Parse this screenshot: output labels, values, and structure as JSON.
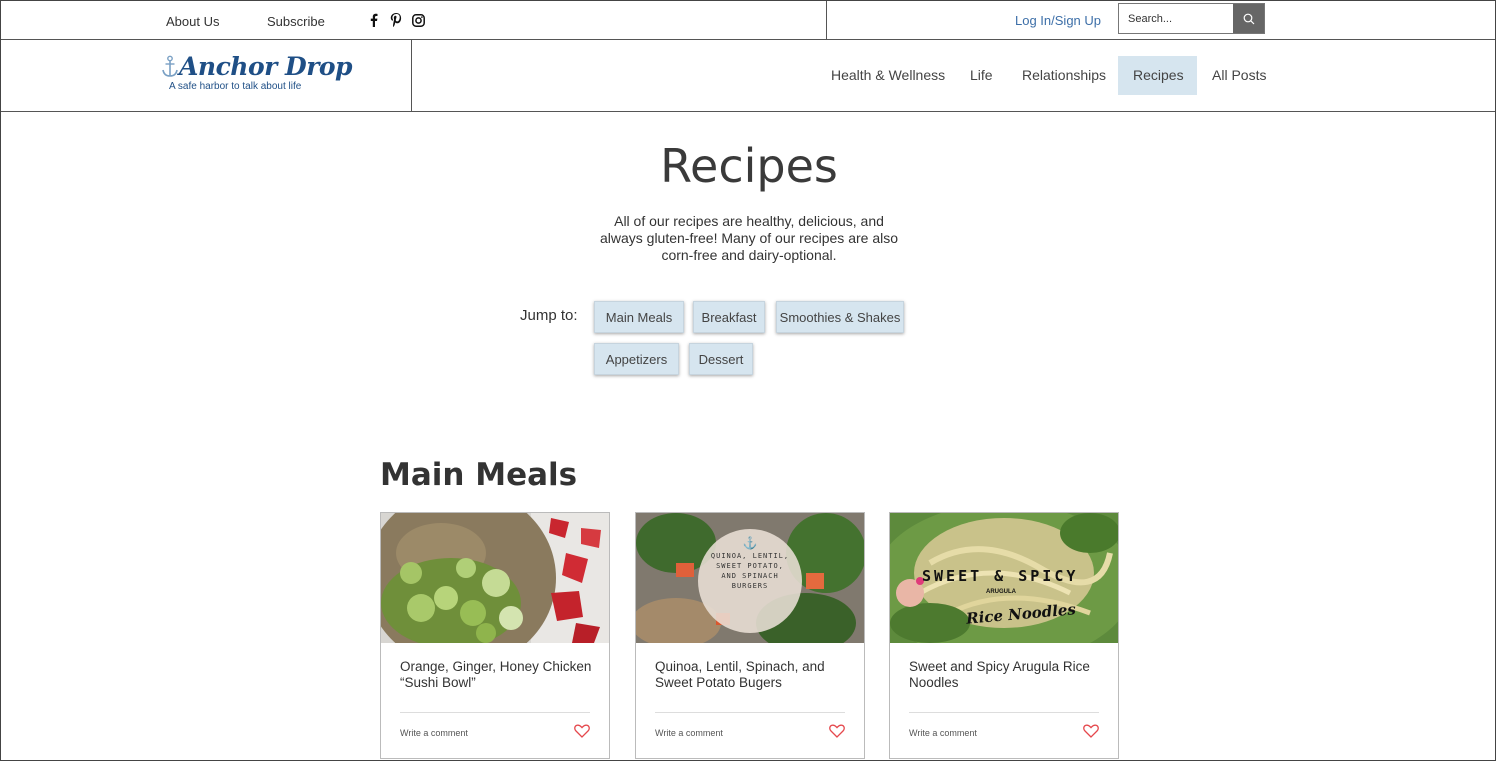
{
  "topbar": {
    "links": [
      "About Us",
      "Subscribe"
    ],
    "social": [
      {
        "name": "facebook-icon",
        "glyph": "f"
      },
      {
        "name": "pinterest-icon",
        "glyph": "P"
      },
      {
        "name": "instagram-icon",
        "glyph": ""
      }
    ],
    "login": "Log In/Sign Up",
    "search_placeholder": "Search..."
  },
  "logo": {
    "brand": "Anchor Drop",
    "tagline": "A safe  harbor  to talk  about  life"
  },
  "nav": {
    "items": [
      "Health & Wellness",
      "Life",
      "Relationships",
      "Recipes",
      "All Posts"
    ],
    "active": "Recipes"
  },
  "page": {
    "title": "Recipes",
    "intro": "All of our recipes are healthy, delicious, and always gluten-free! Many of our recipes are also corn-free and dairy-optional.",
    "jump_label": "Jump to:",
    "jump_chips": [
      "Main Meals",
      "Breakfast",
      "Smoothies & Shakes",
      "Appetizers",
      "Dessert"
    ]
  },
  "section": {
    "title": "Main Meals",
    "cards": [
      {
        "title": "Orange, Ginger, Honey Chicken “Sushi Bowl”",
        "comment": "Write a comment",
        "overlay": ""
      },
      {
        "title": "Quinoa, Lentil, Spinach, and Sweet Potato Bugers",
        "comment": "Write a comment",
        "overlay": "QUINOA, LENTIL, SWEET POTATO, AND SPINACH BURGERS"
      },
      {
        "title": "Sweet and Spicy Arugula Rice Noodles",
        "comment": "Write a comment",
        "overlay_top": "SWEET & SPICY",
        "overlay_mid": "ARUGULA",
        "overlay_bottom": "Rice Noodles"
      }
    ]
  },
  "colors": {
    "accent_blue": "#3d6fa8",
    "brand_blue": "#1f4f86",
    "chip_bg": "#d6e5ef",
    "heart_red": "#e5484d"
  }
}
